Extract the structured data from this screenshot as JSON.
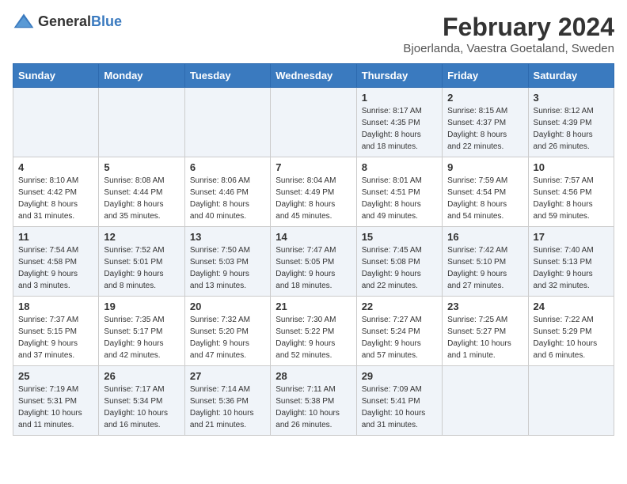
{
  "header": {
    "logo_general": "General",
    "logo_blue": "Blue",
    "title": "February 2024",
    "subtitle": "Bjoerlanda, Vaestra Goetaland, Sweden"
  },
  "weekdays": [
    "Sunday",
    "Monday",
    "Tuesday",
    "Wednesday",
    "Thursday",
    "Friday",
    "Saturday"
  ],
  "weeks": [
    [
      {
        "day": "",
        "info": ""
      },
      {
        "day": "",
        "info": ""
      },
      {
        "day": "",
        "info": ""
      },
      {
        "day": "",
        "info": ""
      },
      {
        "day": "1",
        "info": "Sunrise: 8:17 AM\nSunset: 4:35 PM\nDaylight: 8 hours\nand 18 minutes."
      },
      {
        "day": "2",
        "info": "Sunrise: 8:15 AM\nSunset: 4:37 PM\nDaylight: 8 hours\nand 22 minutes."
      },
      {
        "day": "3",
        "info": "Sunrise: 8:12 AM\nSunset: 4:39 PM\nDaylight: 8 hours\nand 26 minutes."
      }
    ],
    [
      {
        "day": "4",
        "info": "Sunrise: 8:10 AM\nSunset: 4:42 PM\nDaylight: 8 hours\nand 31 minutes."
      },
      {
        "day": "5",
        "info": "Sunrise: 8:08 AM\nSunset: 4:44 PM\nDaylight: 8 hours\nand 35 minutes."
      },
      {
        "day": "6",
        "info": "Sunrise: 8:06 AM\nSunset: 4:46 PM\nDaylight: 8 hours\nand 40 minutes."
      },
      {
        "day": "7",
        "info": "Sunrise: 8:04 AM\nSunset: 4:49 PM\nDaylight: 8 hours\nand 45 minutes."
      },
      {
        "day": "8",
        "info": "Sunrise: 8:01 AM\nSunset: 4:51 PM\nDaylight: 8 hours\nand 49 minutes."
      },
      {
        "day": "9",
        "info": "Sunrise: 7:59 AM\nSunset: 4:54 PM\nDaylight: 8 hours\nand 54 minutes."
      },
      {
        "day": "10",
        "info": "Sunrise: 7:57 AM\nSunset: 4:56 PM\nDaylight: 8 hours\nand 59 minutes."
      }
    ],
    [
      {
        "day": "11",
        "info": "Sunrise: 7:54 AM\nSunset: 4:58 PM\nDaylight: 9 hours\nand 3 minutes."
      },
      {
        "day": "12",
        "info": "Sunrise: 7:52 AM\nSunset: 5:01 PM\nDaylight: 9 hours\nand 8 minutes."
      },
      {
        "day": "13",
        "info": "Sunrise: 7:50 AM\nSunset: 5:03 PM\nDaylight: 9 hours\nand 13 minutes."
      },
      {
        "day": "14",
        "info": "Sunrise: 7:47 AM\nSunset: 5:05 PM\nDaylight: 9 hours\nand 18 minutes."
      },
      {
        "day": "15",
        "info": "Sunrise: 7:45 AM\nSunset: 5:08 PM\nDaylight: 9 hours\nand 22 minutes."
      },
      {
        "day": "16",
        "info": "Sunrise: 7:42 AM\nSunset: 5:10 PM\nDaylight: 9 hours\nand 27 minutes."
      },
      {
        "day": "17",
        "info": "Sunrise: 7:40 AM\nSunset: 5:13 PM\nDaylight: 9 hours\nand 32 minutes."
      }
    ],
    [
      {
        "day": "18",
        "info": "Sunrise: 7:37 AM\nSunset: 5:15 PM\nDaylight: 9 hours\nand 37 minutes."
      },
      {
        "day": "19",
        "info": "Sunrise: 7:35 AM\nSunset: 5:17 PM\nDaylight: 9 hours\nand 42 minutes."
      },
      {
        "day": "20",
        "info": "Sunrise: 7:32 AM\nSunset: 5:20 PM\nDaylight: 9 hours\nand 47 minutes."
      },
      {
        "day": "21",
        "info": "Sunrise: 7:30 AM\nSunset: 5:22 PM\nDaylight: 9 hours\nand 52 minutes."
      },
      {
        "day": "22",
        "info": "Sunrise: 7:27 AM\nSunset: 5:24 PM\nDaylight: 9 hours\nand 57 minutes."
      },
      {
        "day": "23",
        "info": "Sunrise: 7:25 AM\nSunset: 5:27 PM\nDaylight: 10 hours\nand 1 minute."
      },
      {
        "day": "24",
        "info": "Sunrise: 7:22 AM\nSunset: 5:29 PM\nDaylight: 10 hours\nand 6 minutes."
      }
    ],
    [
      {
        "day": "25",
        "info": "Sunrise: 7:19 AM\nSunset: 5:31 PM\nDaylight: 10 hours\nand 11 minutes."
      },
      {
        "day": "26",
        "info": "Sunrise: 7:17 AM\nSunset: 5:34 PM\nDaylight: 10 hours\nand 16 minutes."
      },
      {
        "day": "27",
        "info": "Sunrise: 7:14 AM\nSunset: 5:36 PM\nDaylight: 10 hours\nand 21 minutes."
      },
      {
        "day": "28",
        "info": "Sunrise: 7:11 AM\nSunset: 5:38 PM\nDaylight: 10 hours\nand 26 minutes."
      },
      {
        "day": "29",
        "info": "Sunrise: 7:09 AM\nSunset: 5:41 PM\nDaylight: 10 hours\nand 31 minutes."
      },
      {
        "day": "",
        "info": ""
      },
      {
        "day": "",
        "info": ""
      }
    ]
  ]
}
